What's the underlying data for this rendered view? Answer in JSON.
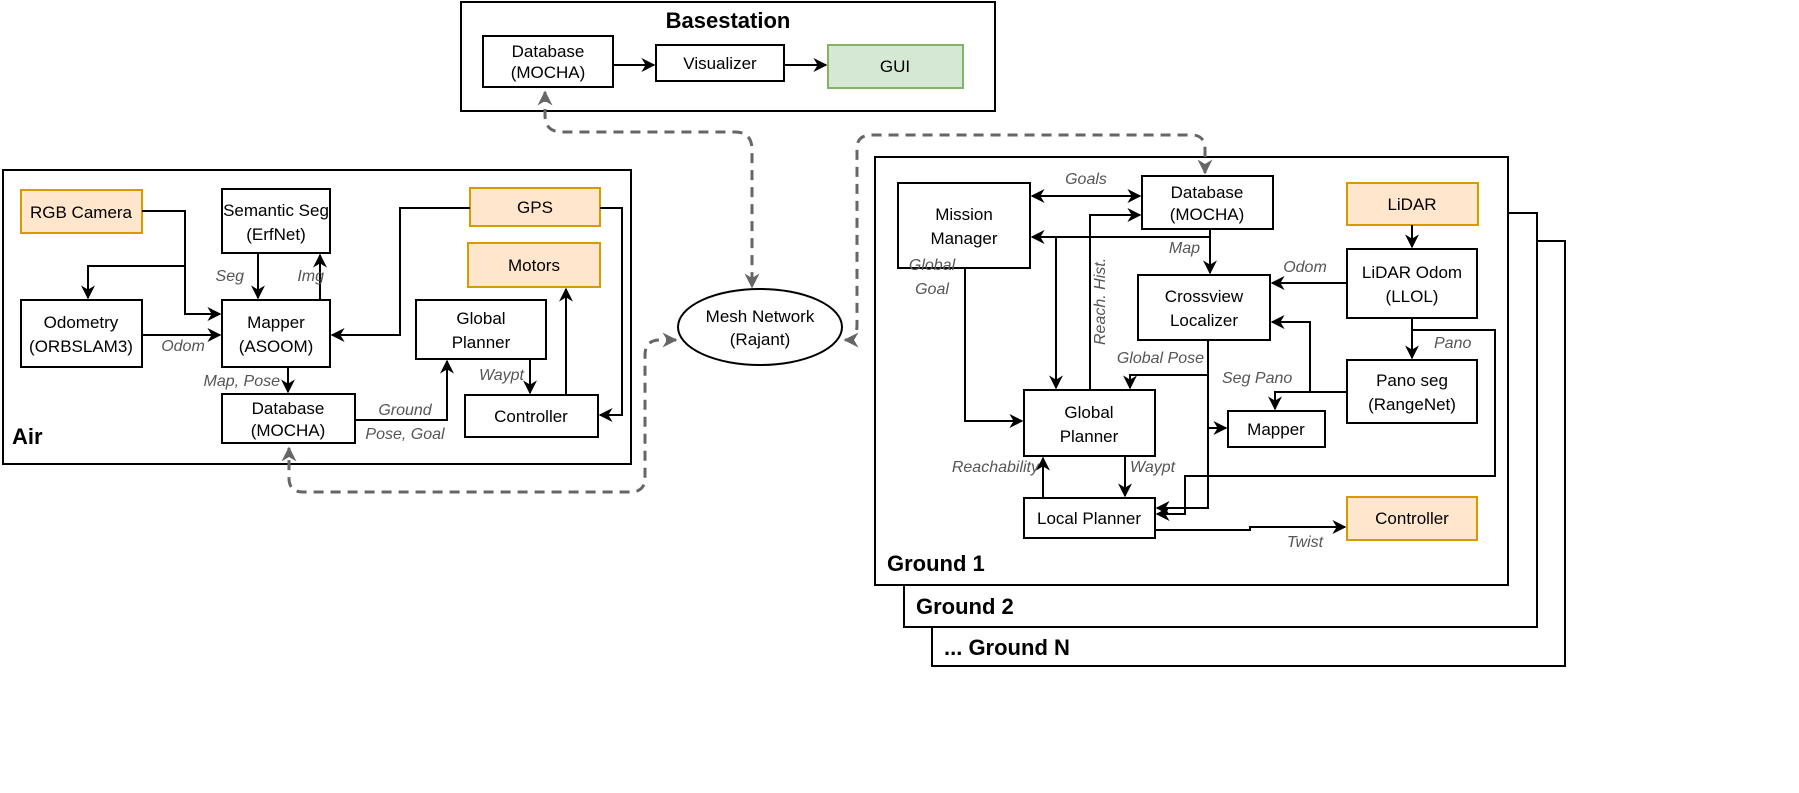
{
  "basestation": {
    "title": "Basestation",
    "database": [
      "Database",
      "(MOCHA)"
    ],
    "visualizer": "Visualizer",
    "gui": "GUI"
  },
  "air": {
    "title": "Air",
    "rgb_camera": "RGB Camera",
    "semantic_seg": [
      "Semantic Seg",
      "(ErfNet)"
    ],
    "gps": "GPS",
    "motors": "Motors",
    "odometry": [
      "Odometry",
      "(ORBSLAM3)"
    ],
    "mapper": [
      "Mapper",
      "(ASOOM)"
    ],
    "global_planner": [
      "Global",
      "Planner"
    ],
    "database": [
      "Database",
      "(MOCHA)"
    ],
    "controller": "Controller",
    "labels": {
      "seg": "Seg",
      "img": "Img",
      "odom": "Odom",
      "map_pose": "Map, Pose",
      "ground": "Ground",
      "pose_goal": "Pose, Goal",
      "waypt": "Waypt"
    }
  },
  "mesh": [
    "Mesh Network",
    "(Rajant)"
  ],
  "ground": {
    "titles": [
      "Ground 1",
      "Ground 2",
      "... Ground N"
    ],
    "mission_manager": [
      "Mission",
      "Manager"
    ],
    "database": [
      "Database",
      "(MOCHA)"
    ],
    "lidar": "LiDAR",
    "crossview": [
      "Crossview",
      "Localizer"
    ],
    "lidar_odom": [
      "LiDAR Odom",
      "(LLOL)"
    ],
    "global_planner": [
      "Global",
      "Planner"
    ],
    "pano_seg": [
      "Pano seg",
      "(RangeNet)"
    ],
    "mapper": "Mapper",
    "local_planner": "Local Planner",
    "controller": "Controller",
    "labels": {
      "goals": "Goals",
      "map": "Map",
      "odom": "Odom",
      "global_goal": [
        "Global",
        "Goal"
      ],
      "reach_hist": "Reach. Hist.",
      "global_pose": "Global Pose",
      "seg_pano": "Seg Pano",
      "pano": "Pano",
      "reachability": "Reachability",
      "waypt": "Waypt",
      "twist": "Twist"
    }
  },
  "colors": {
    "sensor_fill": "#ffe6cc",
    "sensor_stroke": "#d79b00",
    "gui_fill": "#d5e8d4",
    "gui_stroke": "#82b366",
    "link": "#666666"
  }
}
